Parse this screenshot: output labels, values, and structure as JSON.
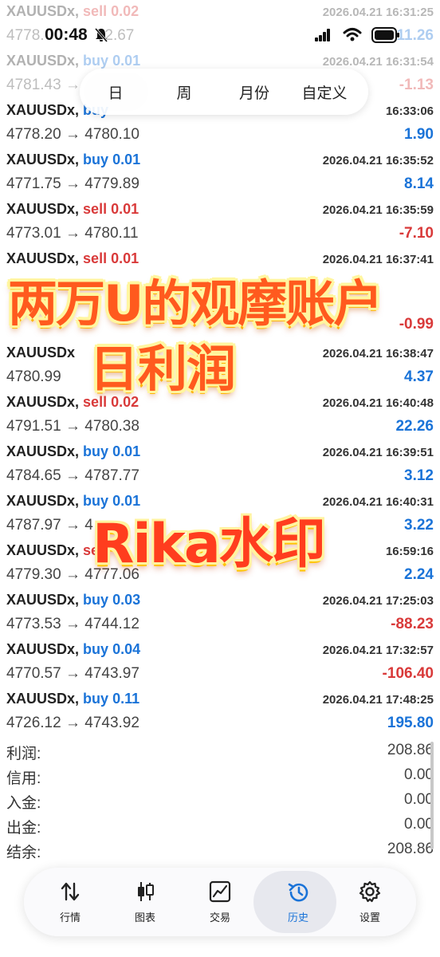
{
  "status_bar": {
    "time": "00:48"
  },
  "period_tabs": [
    "日",
    "周",
    "月份",
    "自定义"
  ],
  "active_period": "日",
  "trades": [
    {
      "symbol": "XAUUSDx",
      "side": "sell",
      "volume": "0.02",
      "time": "2026.04.21 16:31:25",
      "open": "4778.",
      "close": "72.67",
      "profit": "11.26",
      "faded": true
    },
    {
      "symbol": "XAUUSDx",
      "side": "buy",
      "volume": "0.01",
      "time": "2026.04.21 16:31:54",
      "open": "4781.43",
      "close": "",
      "profit": "-1.13",
      "faded": true
    },
    {
      "symbol": "XAUUSDx",
      "side": "buy",
      "volume": "",
      "time": "16:33:06",
      "open": "4778.20",
      "close": "4780.10",
      "profit": "1.90"
    },
    {
      "symbol": "XAUUSDx",
      "side": "buy",
      "volume": "0.01",
      "time": "2026.04.21 16:35:52",
      "open": "4771.75",
      "close": "4779.89",
      "profit": "8.14"
    },
    {
      "symbol": "XAUUSDx",
      "side": "sell",
      "volume": "0.01",
      "time": "2026.04.21 16:35:59",
      "open": "4773.01",
      "close": "4780.11",
      "profit": "-7.10"
    },
    {
      "symbol": "XAUUSDx",
      "side": "sell",
      "volume": "0.01",
      "time": "2026.04.21 16:37:41",
      "open": "",
      "close": "",
      "profit": "-0.99"
    },
    {
      "symbol": "XAUUSDx",
      "side": "",
      "volume": "",
      "time": "2026.04.21 16:38:47",
      "open": "4780.99",
      "close": "",
      "profit": "4.37"
    },
    {
      "symbol": "XAUUSDx",
      "side": "sell",
      "volume": "0.02",
      "time": "2026.04.21 16:40:48",
      "open": "4791.51",
      "close": "4780.38",
      "profit": "22.26"
    },
    {
      "symbol": "XAUUSDx",
      "side": "buy",
      "volume": "0.01",
      "time": "2026.04.21 16:39:51",
      "open": "4784.65",
      "close": "4787.77",
      "profit": "3.12"
    },
    {
      "symbol": "XAUUSDx",
      "side": "buy",
      "volume": "0.01",
      "time": "2026.04.21 16:40:31",
      "open": "4787.97",
      "close": "",
      "profit": "3.22"
    },
    {
      "symbol": "XAUUSDx",
      "side": "sell",
      "volume": "",
      "time": "16:59:16",
      "open": "4779.30",
      "close": "4777.06",
      "profit": "2.24"
    },
    {
      "symbol": "XAUUSDx",
      "side": "buy",
      "volume": "0.03",
      "time": "2026.04.21 17:25:03",
      "open": "4773.53",
      "close": "4744.12",
      "profit": "-88.23"
    },
    {
      "symbol": "XAUUSDx",
      "side": "buy",
      "volume": "0.04",
      "time": "2026.04.21 17:32:57",
      "open": "4770.57",
      "close": "4743.97",
      "profit": "-106.40"
    },
    {
      "symbol": "XAUUSDx",
      "side": "buy",
      "volume": "0.11",
      "time": "2026.04.21 17:48:25",
      "open": "4726.12",
      "close": "4743.92",
      "profit": "195.80"
    }
  ],
  "summary": [
    {
      "label": "利润:",
      "value": "208.86"
    },
    {
      "label": "信用:",
      "value": "0.00"
    },
    {
      "label": "入金:",
      "value": "0.00"
    },
    {
      "label": "出金:",
      "value": "0.00"
    },
    {
      "label": "结余:",
      "value": "208.86"
    }
  ],
  "overlay": {
    "title_line1": "两万U的观摩账户",
    "title_line2": "日利润",
    "watermark": "Rika水印"
  },
  "bottom_nav": [
    {
      "label": "行情",
      "icon": "updown-arrows-icon"
    },
    {
      "label": "图表",
      "icon": "candlestick-icon"
    },
    {
      "label": "交易",
      "icon": "trade-chart-icon"
    },
    {
      "label": "历史",
      "icon": "history-clock-icon"
    },
    {
      "label": "设置",
      "icon": "gear-icon"
    }
  ],
  "active_nav": "历史",
  "colors": {
    "buy": "#1a73d8",
    "sell": "#d93a3a",
    "positive": "#1a73d8",
    "negative": "#d93a3a",
    "overlay": "#ff5a1e"
  }
}
